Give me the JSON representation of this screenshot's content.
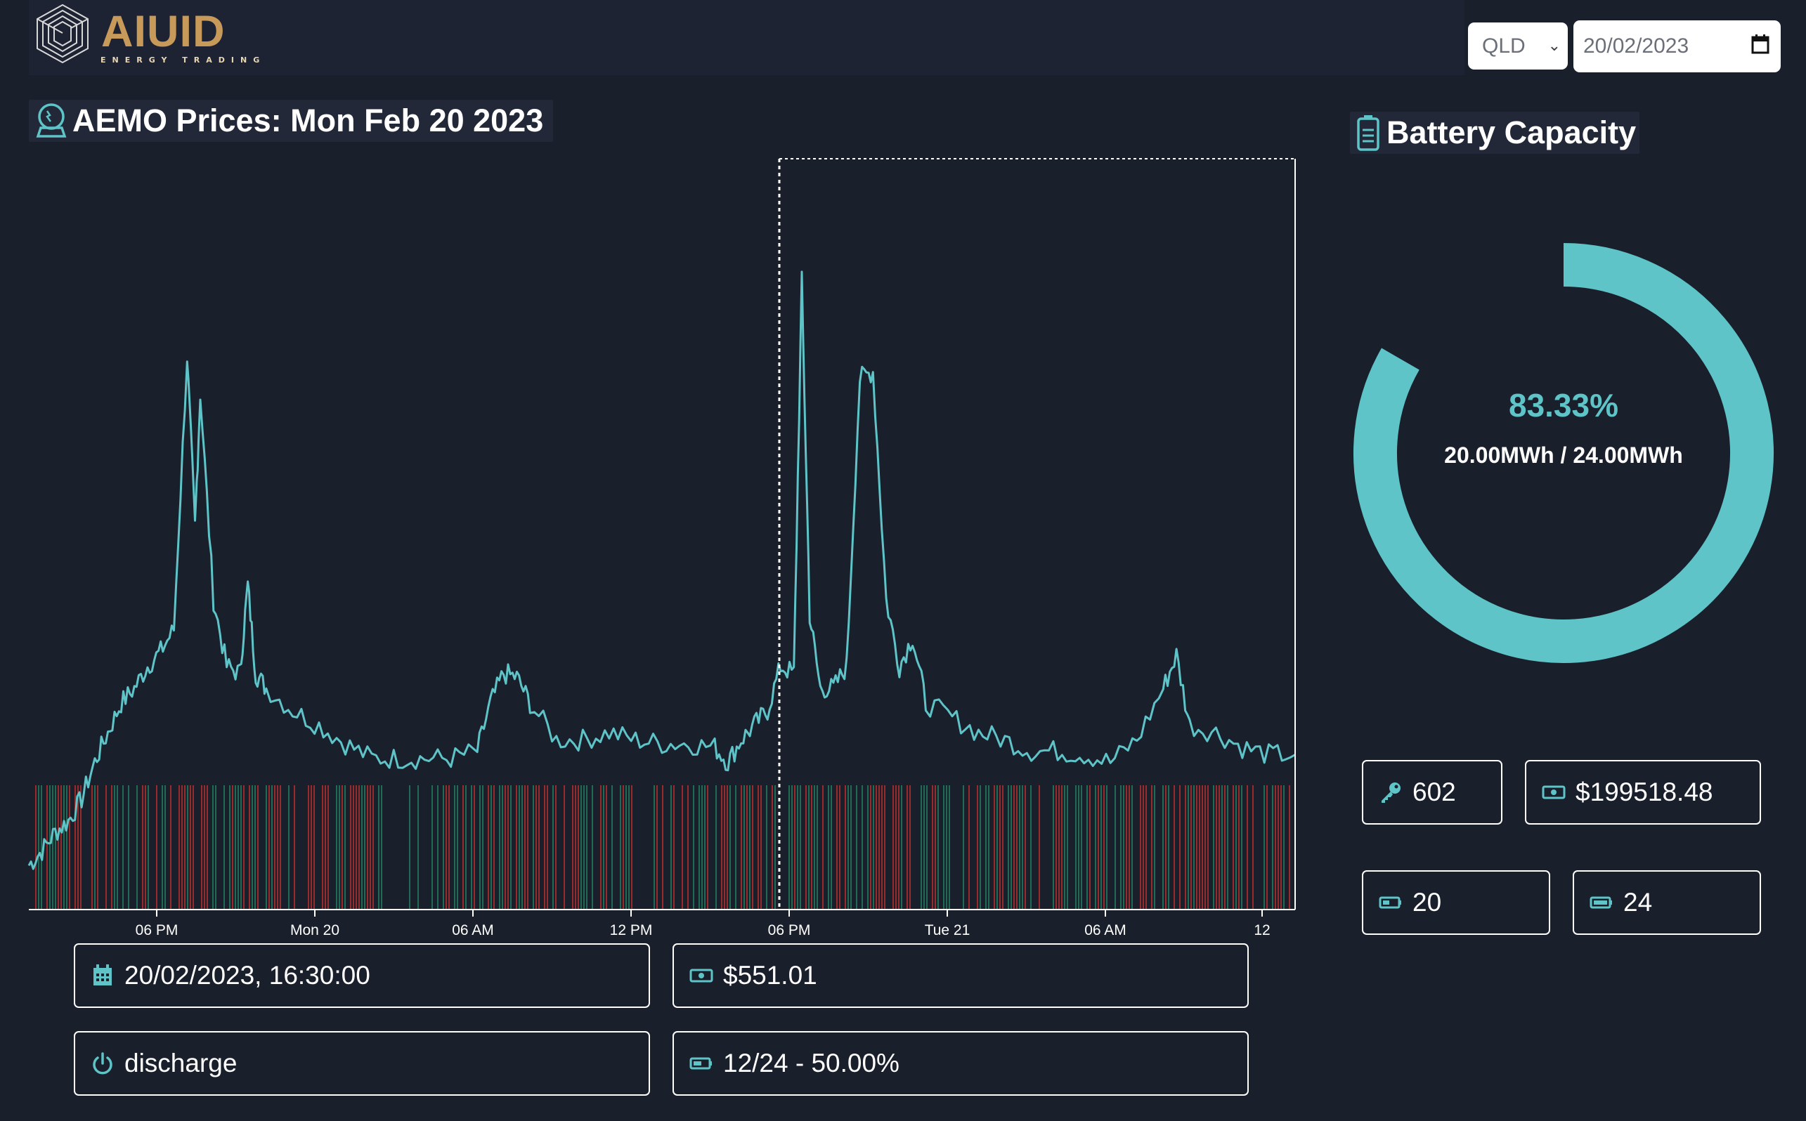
{
  "header": {
    "logo_text": "AIUID",
    "logo_subtitle": "ENERGY TRADING",
    "region_select": {
      "selected": "QLD"
    },
    "date_input": {
      "value": "20/02/2023"
    }
  },
  "prices_panel": {
    "title": "AEMO Prices: Mon Feb 20 2023"
  },
  "chart_data": {
    "type": "line",
    "x_tick_labels": [
      "06 PM",
      "Mon 20",
      "06 AM",
      "12 PM",
      "06 PM",
      "Tue 21",
      "06 AM",
      "12"
    ],
    "series": [
      {
        "values": [
          {
            "t": 0,
            "p": 60
          },
          {
            "t": 0.5,
            "p": 80
          },
          {
            "t": 1,
            "p": 105
          },
          {
            "t": 1.5,
            "p": 120
          },
          {
            "t": 2,
            "p": 150
          },
          {
            "t": 2.5,
            "p": 200
          },
          {
            "t": 3,
            "p": 240
          },
          {
            "t": 3.5,
            "p": 280
          },
          {
            "t": 4,
            "p": 300
          },
          {
            "t": 4.5,
            "p": 330
          },
          {
            "t": 5,
            "p": 350
          },
          {
            "t": 5.5,
            "p": 380
          },
          {
            "t": 6,
            "p": 750
          },
          {
            "t": 6.3,
            "p": 520
          },
          {
            "t": 6.5,
            "p": 700
          },
          {
            "t": 7,
            "p": 420
          },
          {
            "t": 7.5,
            "p": 330
          },
          {
            "t": 8,
            "p": 320
          },
          {
            "t": 8.3,
            "p": 440
          },
          {
            "t": 8.6,
            "p": 320
          },
          {
            "t": 9,
            "p": 300
          },
          {
            "t": 10,
            "p": 270
          },
          {
            "t": 11,
            "p": 250
          },
          {
            "t": 12,
            "p": 225
          },
          {
            "t": 13,
            "p": 205
          },
          {
            "t": 14,
            "p": 205
          },
          {
            "t": 15,
            "p": 205
          },
          {
            "t": 16,
            "p": 205
          },
          {
            "t": 17,
            "p": 215
          },
          {
            "t": 17.5,
            "p": 280
          },
          {
            "t": 18,
            "p": 320
          },
          {
            "t": 18.5,
            "p": 315
          },
          {
            "t": 19,
            "p": 280
          },
          {
            "t": 20,
            "p": 230
          },
          {
            "t": 21,
            "p": 230
          },
          {
            "t": 22,
            "p": 240
          },
          {
            "t": 23,
            "p": 230
          },
          {
            "t": 24,
            "p": 225
          },
          {
            "t": 25,
            "p": 225
          },
          {
            "t": 26,
            "p": 220
          },
          {
            "t": 26.5,
            "p": 200
          },
          {
            "t": 27,
            "p": 230
          },
          {
            "t": 27.5,
            "p": 250
          },
          {
            "t": 28,
            "p": 270
          },
          {
            "t": 28.5,
            "p": 330
          },
          {
            "t": 29,
            "p": 320
          },
          {
            "t": 29.3,
            "p": 851
          },
          {
            "t": 29.6,
            "p": 400
          },
          {
            "t": 30,
            "p": 300
          },
          {
            "t": 30.5,
            "p": 300
          },
          {
            "t": 31,
            "p": 330
          },
          {
            "t": 31.5,
            "p": 720
          },
          {
            "t": 32,
            "p": 730
          },
          {
            "t": 32.5,
            "p": 420
          },
          {
            "t": 33,
            "p": 330
          },
          {
            "t": 33.5,
            "p": 370
          },
          {
            "t": 34,
            "p": 280
          },
          {
            "t": 35,
            "p": 260
          },
          {
            "t": 36,
            "p": 240
          },
          {
            "t": 37,
            "p": 230
          },
          {
            "t": 38,
            "p": 215
          },
          {
            "t": 39,
            "p": 215
          },
          {
            "t": 40,
            "p": 210
          },
          {
            "t": 41,
            "p": 200
          },
          {
            "t": 42,
            "p": 230
          },
          {
            "t": 43,
            "p": 300
          },
          {
            "t": 43.5,
            "p": 345
          },
          {
            "t": 44,
            "p": 250
          },
          {
            "t": 45,
            "p": 240
          },
          {
            "t": 46,
            "p": 220
          },
          {
            "t": 47,
            "p": 210
          },
          {
            "t": 48,
            "p": 210
          }
        ]
      }
    ],
    "cursor_time": "20/02/2023, 16:30:00",
    "signal_bars": "red = discharge, green = charge"
  },
  "info_boxes": {
    "datetime": "20/02/2023, 16:30:00",
    "price": "$551.01",
    "action": "discharge",
    "battery_state": "12/24 - 50.00%"
  },
  "battery_panel": {
    "title": "Battery Capacity",
    "percent_text": "83.33%",
    "percent_value": 0.8333,
    "capacity_text": "20.00MWh / 24.00MWh",
    "stats": {
      "key_value": "602",
      "money_value": "$199518.48",
      "battery_a": "20",
      "battery_b": "24"
    }
  },
  "colors": {
    "background": "#1a1f2c",
    "accent": "#5ec4c7",
    "discharge_bar": "#9b2b2b",
    "charge_bar": "#1f6b54"
  }
}
